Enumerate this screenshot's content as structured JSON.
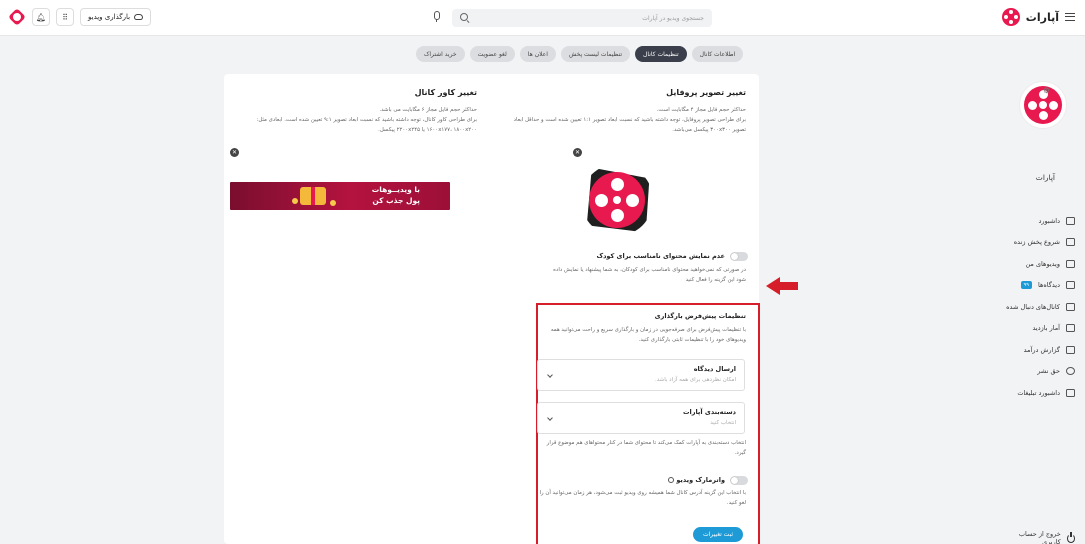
{
  "header": {
    "brand": "آپارات",
    "search_placeholder": "جستجوی ویدیو در آپارات",
    "upload_label": "بارگذاری ویدیو"
  },
  "sidebar": {
    "channel_name": "آپارات",
    "items": [
      {
        "label": "داشبورد",
        "icon": "dashboard-icon"
      },
      {
        "label": "شروع پخش زنده",
        "icon": "live-icon"
      },
      {
        "label": "ویدیوهای من",
        "icon": "videos-icon"
      },
      {
        "label": "دیدگاه‌ها",
        "icon": "comments-icon",
        "badge": "۹۹"
      },
      {
        "label": "کانال‌های دنبال شده",
        "icon": "followed-icon"
      },
      {
        "label": "آمار بازدید",
        "icon": "stats-icon"
      },
      {
        "label": "گزارش درآمد",
        "icon": "income-icon"
      },
      {
        "label": "حق نشر",
        "icon": "copyright-icon"
      },
      {
        "label": "داشبورد تبلیغات",
        "icon": "ads-icon"
      }
    ],
    "logout_label": "خروج از حساب کاربری"
  },
  "tabs": [
    {
      "label": "اطلاعات کانال",
      "active": false
    },
    {
      "label": "تنظیمات کانال",
      "active": true
    },
    {
      "label": "تنظیمات لیست پخش",
      "active": false
    },
    {
      "label": "اعلان ها",
      "active": false
    },
    {
      "label": "لغو عضویت",
      "active": false
    },
    {
      "label": "خرید اشتراک",
      "active": false
    }
  ],
  "profile": {
    "title": "تغییر تصویر پروفایل",
    "desc_1": "حداکثر حجم فایل مجاز ۴ مگابایت است.",
    "desc_2": "برای طراحی تصویر پروفایل، توجه داشته باشید که نسبت ابعاد تصویر ۱:۱ تعیین شده است و حداقل ابعاد",
    "desc_3": "تصویر ۳۰۰x۳۰۰ پیکسل می‌باشد."
  },
  "cover": {
    "title": "تغییر کاور کانال",
    "desc_1": "حداکثر حجم فایل مجاز ۶ مگابایت می باشد.",
    "desc_2": "برای طراحی کاور کانال، توجه داشته باشید که نسبت ابعاد تصویر ۹:۱ تعیین شده است. ابعادی مثل:",
    "desc_3": "۱۶۰۰x۱۷۷، ۱۸۰۰x۲۰۰ یا ۲۲۰۰x۲۴۵ پیکسل.",
    "banner_line1": "با ویدیــوهات",
    "banner_line2": "پول جذب کن"
  },
  "kids": {
    "title": "عدم نمایش محتوای نامناسب برای کودک",
    "desc_1": "در صورتی که نمی‌خواهید محتوای نامناسب برای کودکان، به شما پیشنهاد یا نمایش داده",
    "desc_2": "شود این گزینه را فعال کنید"
  },
  "upload_defaults": {
    "title": "تنظیمات پیش‌فرض بارگذاری",
    "desc_1": "با تنظیمات پیش‌فرض برای صرفه‌جویی در زمان و بارگذاری سریع و راحت می‌توانید همه",
    "desc_2": "ویدیوهای خود را با تنظیمات ثابتی بارگذاری کنید.",
    "comments_label": "ارسال دیدگاه",
    "comments_placeholder": "امکان نظردهی برای همه آزاد باشد.",
    "category_label": "دسته‌بندی آپارات",
    "category_placeholder": "انتخاب کنید",
    "category_help_1": "انتخاب دسته‌بندی به آپارات کمک می‌کند تا محتوای شما در کنار محتواهای هم موضوع قرار",
    "category_help_2": "گیرد.",
    "watermark_label": "واترمارک ویدیو",
    "watermark_desc_1": "با انتخاب این گزینه آدرس کانال شما همیشه روی ویدیو ثبت می‌شود، هر زمان می‌توانید آن را",
    "watermark_desc_2": "لغو کنید.",
    "submit_label": "ثبت تغییرات"
  },
  "colors": {
    "brand": "#e8194f",
    "accent": "#1e9bd7",
    "highlight": "#d51e2a"
  }
}
